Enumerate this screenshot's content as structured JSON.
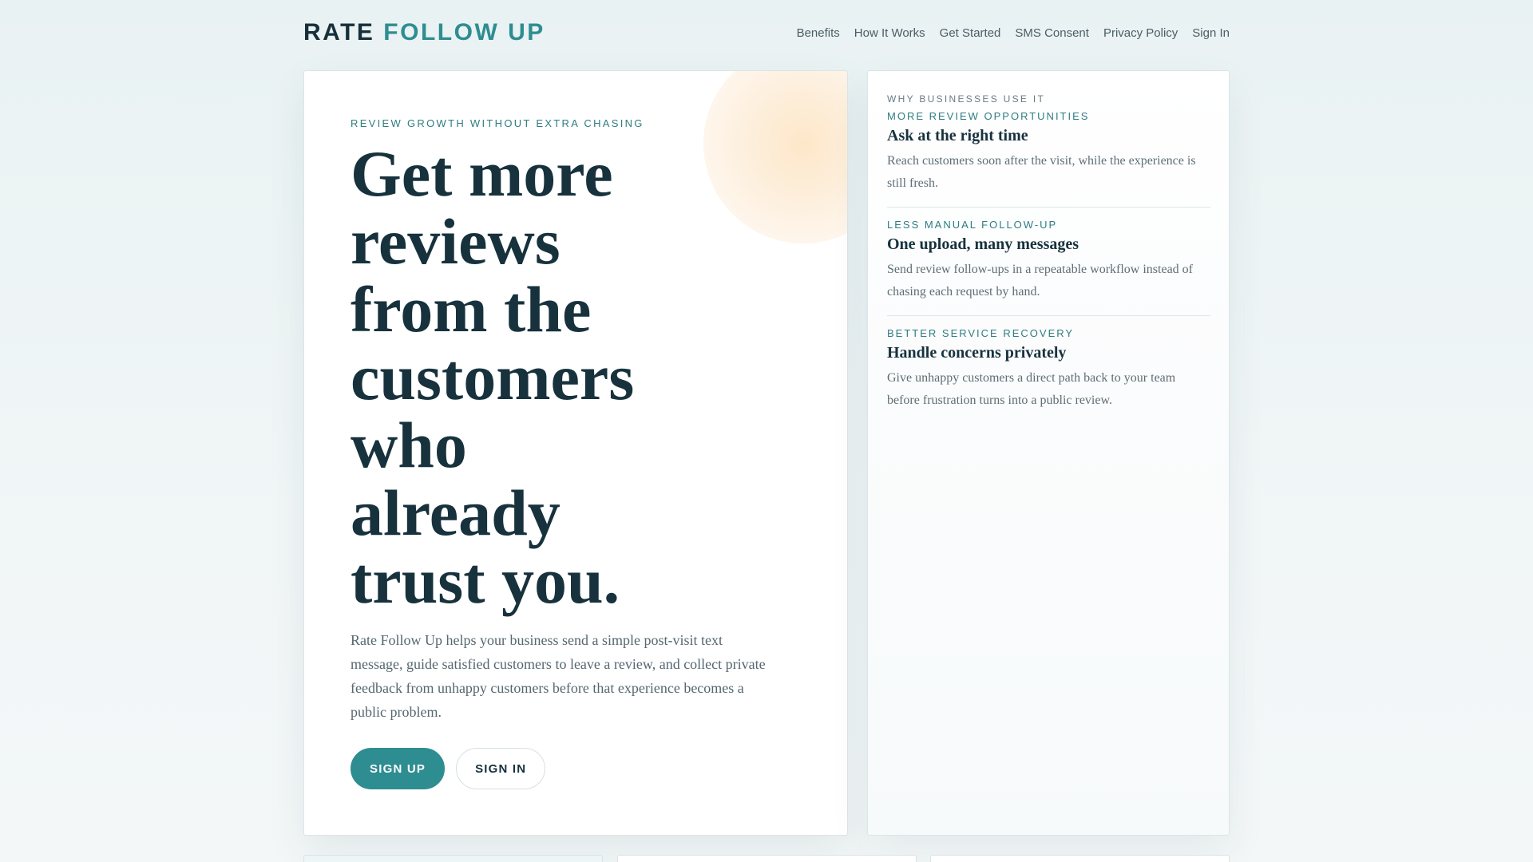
{
  "brand": {
    "word1": "RATE",
    "word2": "FOLLOW UP"
  },
  "nav": {
    "items": [
      "Benefits",
      "How It Works",
      "Get Started",
      "SMS Consent",
      "Privacy Policy",
      "Sign In"
    ]
  },
  "hero": {
    "eyebrow": "REVIEW GROWTH WITHOUT EXTRA CHASING",
    "headline": "Get more reviews from the customers who already trust you.",
    "lead": "Rate Follow Up helps your business send a simple post-visit text message, guide satisfied customers to leave a review, and collect private feedback from unhappy customers before that experience becomes a public problem.",
    "signup_label": "SIGN UP",
    "signin_label": "SIGN IN"
  },
  "side": {
    "eyebrow": "WHY BUSINESSES USE IT",
    "benefits": [
      {
        "tag": "MORE REVIEW OPPORTUNITIES",
        "title": "Ask at the right time",
        "desc": "Reach customers soon after the visit, while the experience is still fresh."
      },
      {
        "tag": "LESS MANUAL FOLLOW-UP",
        "title": "One upload, many messages",
        "desc": "Send review follow-ups in a repeatable workflow instead of chasing each request by hand."
      },
      {
        "tag": "BETTER SERVICE RECOVERY",
        "title": "Handle concerns privately",
        "desc": "Give unhappy customers a direct path back to your team before frustration turns into a public review."
      }
    ]
  },
  "colors": {
    "accent": "#2e8d91",
    "ink": "#17323d",
    "muted": "#55676f",
    "background": "#eef5f6"
  }
}
